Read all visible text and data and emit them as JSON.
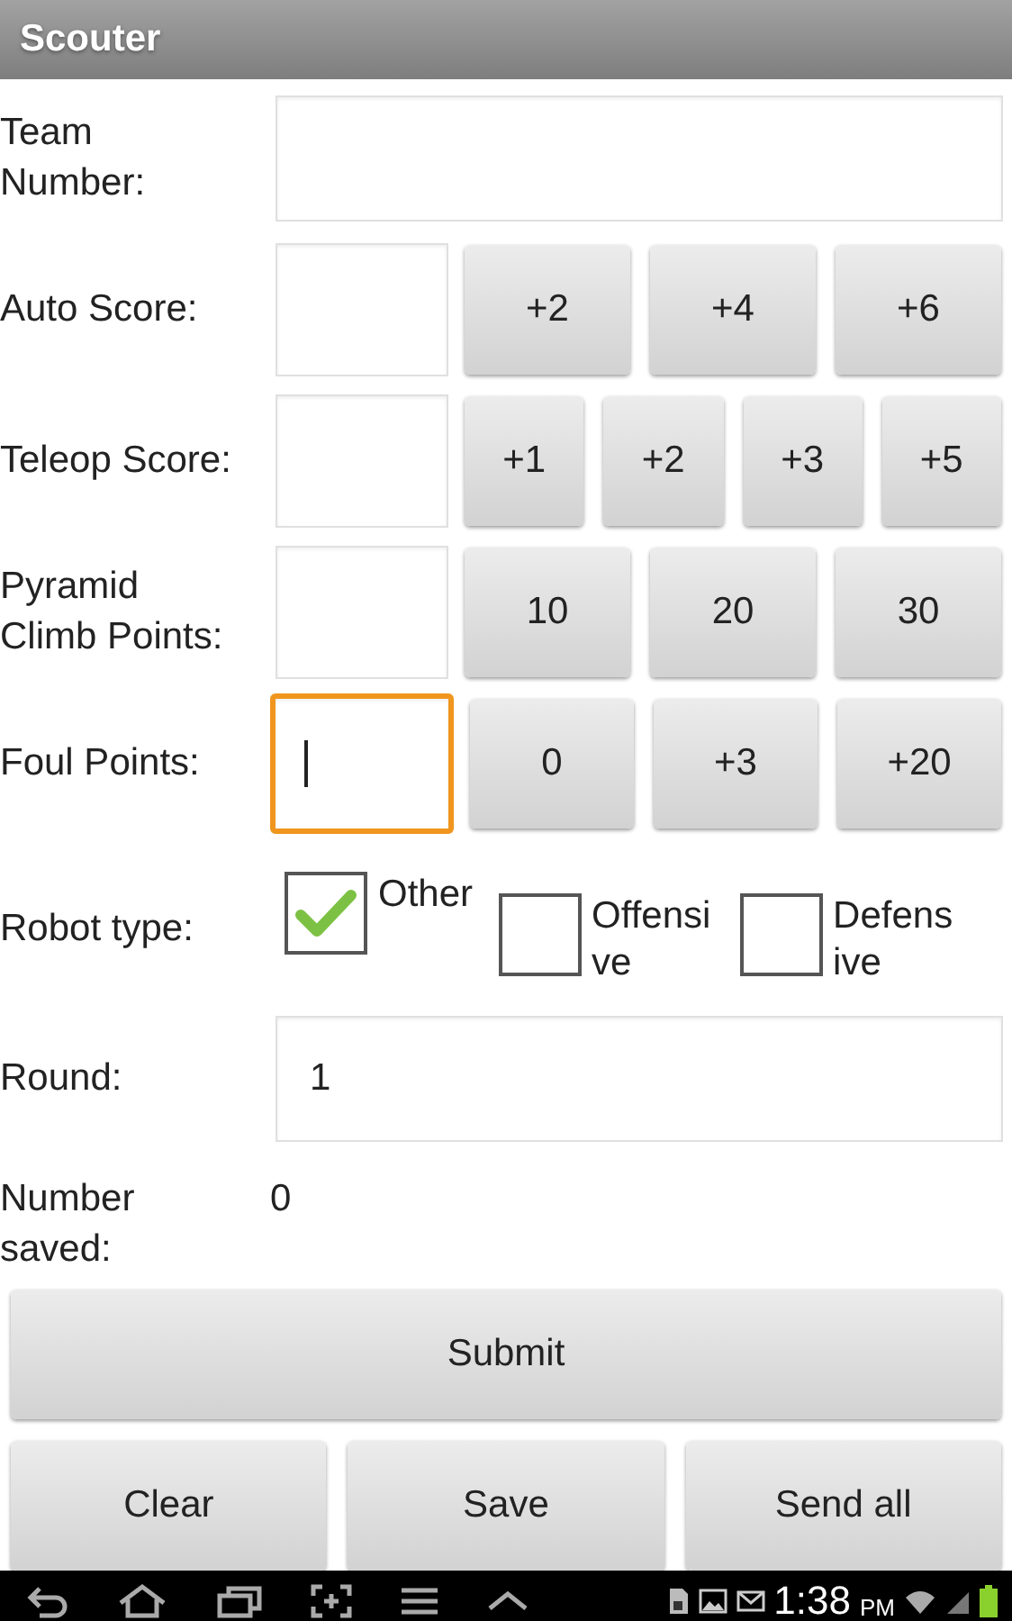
{
  "app_bar": {
    "title": "Scouter"
  },
  "rows": [
    {
      "kind": "wide_field",
      "label": "Team Number:"
    },
    {
      "kind": "score",
      "label": "Auto Score:",
      "focused": false,
      "buttons": [
        "+2",
        "+4",
        "+6"
      ]
    },
    {
      "kind": "score",
      "label": "Teleop Score:",
      "focused": false,
      "buttons": [
        "+1",
        "+2",
        "+3",
        "+5"
      ]
    },
    {
      "kind": "score",
      "label": "Pyramid Climb Points:",
      "focused": false,
      "buttons": [
        "10",
        "20",
        "30"
      ]
    },
    {
      "kind": "score",
      "label": "Foul Points:",
      "focused": true,
      "buttons": [
        "0",
        "+3",
        "+20"
      ]
    },
    {
      "kind": "checkboxes",
      "label": "Robot type:",
      "options": [
        {
          "label": "Other",
          "checked": true
        },
        {
          "label": "Offensive",
          "checked": false
        },
        {
          "label": "Defensive",
          "checked": false
        }
      ]
    },
    {
      "kind": "wide_field",
      "label": "Round:",
      "value": "1"
    },
    {
      "kind": "readout",
      "label": "Number saved:",
      "value": "0"
    }
  ],
  "submit_button": "Submit",
  "actions": [
    "Clear",
    "Save",
    "Send all"
  ],
  "nav_bar": {
    "time": "1:38",
    "meridiem": "PM"
  }
}
